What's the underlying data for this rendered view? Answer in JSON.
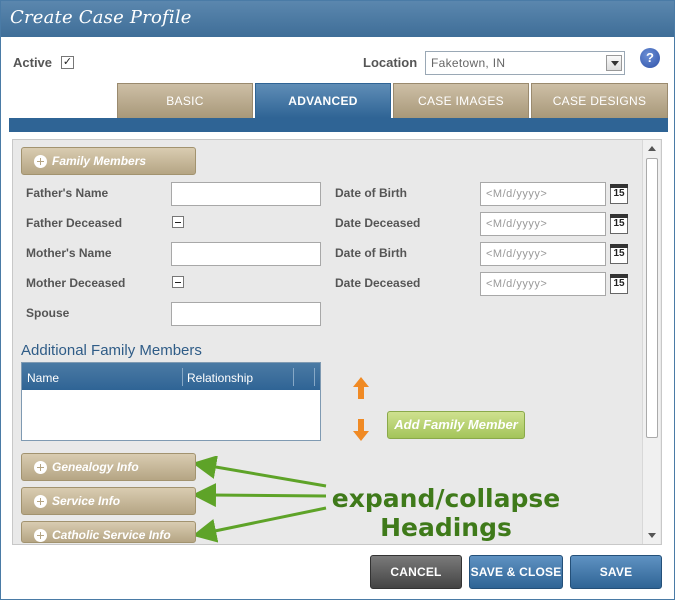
{
  "window": {
    "title": "Create Case Profile"
  },
  "topbar": {
    "active_label": "Active",
    "active_checked": "✓",
    "location_label": "Location",
    "location_value": "Faketown, IN",
    "help_glyph": "?"
  },
  "tabs": [
    {
      "label": "BASIC",
      "active": false
    },
    {
      "label": "ADVANCED",
      "active": true
    },
    {
      "label": "CASE IMAGES",
      "active": false
    },
    {
      "label": "CASE DESIGNS",
      "active": false
    }
  ],
  "family_members": {
    "heading": "Family Members",
    "fathers_name_label": "Father's Name",
    "father_deceased_label": "Father Deceased",
    "mothers_name_label": "Mother's Name",
    "mother_deceased_label": "Mother Deceased",
    "spouse_label": "Spouse",
    "dob_label": "Date of Birth",
    "date_deceased_label": "Date Deceased",
    "date_placeholder": "<M/d/yyyy>",
    "calendar_glyph": "15"
  },
  "additional_family": {
    "heading": "Additional Family Members",
    "columns": [
      "Name",
      "Relationship"
    ],
    "add_button": "Add Family Member"
  },
  "sections": [
    {
      "label": "Genealogy Info"
    },
    {
      "label": "Service Info"
    },
    {
      "label": "Catholic Service Info"
    }
  ],
  "annotation": {
    "line1": "expand/collapse",
    "line2": "Headings"
  },
  "footer": {
    "cancel": "CANCEL",
    "save_close": "SAVE & CLOSE",
    "save": "SAVE"
  },
  "colors": {
    "accent_blue": "#2f6495",
    "tab_tan": "#b5a584",
    "annotation_green": "#3f7a1a",
    "add_button_green": "#a3c45a",
    "arrow_orange": "#f08a24"
  }
}
